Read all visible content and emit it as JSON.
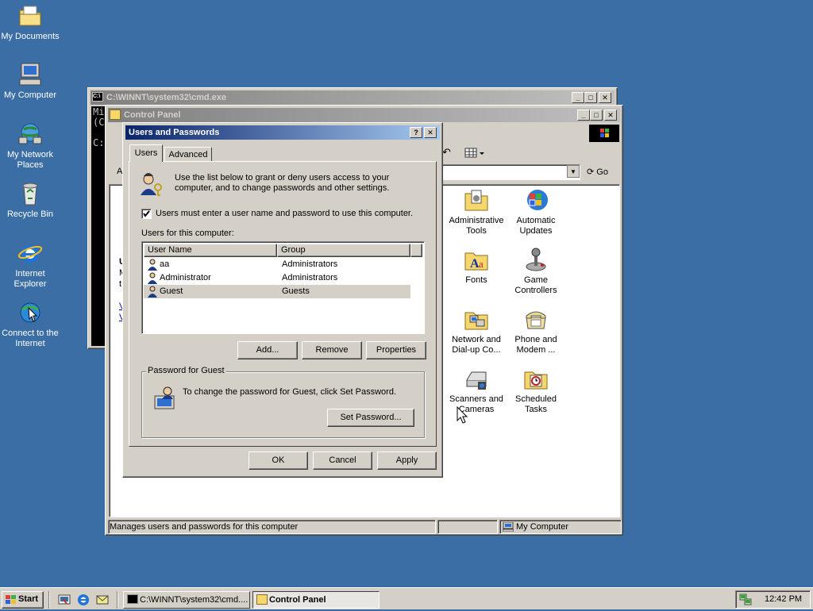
{
  "desktop": {
    "icons": [
      {
        "label": "My Documents"
      },
      {
        "label": "My Computer"
      },
      {
        "label": "My Network Places"
      },
      {
        "label": "Recycle Bin"
      },
      {
        "label": "Internet Explorer"
      },
      {
        "label": "Connect to the Internet"
      }
    ]
  },
  "cmd_window": {
    "title": "C:\\WINNT\\system32\\cmd.exe",
    "lines": [
      "Mi",
      "(C",
      "",
      "C:"
    ]
  },
  "control_panel": {
    "title": "Control Panel",
    "address_partial": "A",
    "go_label": "Go",
    "left_partial": [
      "U",
      "M",
      "t",
      "V",
      "V"
    ],
    "items": [
      {
        "label": "Administrative Tools",
        "icon": "admin-tools-icon"
      },
      {
        "label": "Automatic Updates",
        "icon": "windows-update-icon"
      },
      {
        "label": "Fonts",
        "icon": "fonts-folder-icon"
      },
      {
        "label": "Game Controllers",
        "icon": "joystick-icon"
      },
      {
        "label": "Network and Dial-up Co...",
        "icon": "network-folder-icon"
      },
      {
        "label": "Phone and Modem ...",
        "icon": "phone-icon"
      },
      {
        "label": "Scanners and Cameras",
        "icon": "scanner-icon"
      },
      {
        "label": "Scheduled Tasks",
        "icon": "scheduled-tasks-icon"
      }
    ],
    "status_text": "Manages users and passwords for this computer",
    "status_zone": "My Computer"
  },
  "dialog": {
    "title": "Users and Passwords",
    "help_btn": "?",
    "close_btn": "✕",
    "tabs": [
      {
        "label": "Users"
      },
      {
        "label": "Advanced"
      }
    ],
    "intro": "Use the list below to grant or deny users access to your computer, and to change passwords and other settings.",
    "checkbox_label": "Users must enter a user name and password to use this computer.",
    "checkbox_checked": true,
    "users_label": "Users for this computer:",
    "columns": [
      "User Name",
      "Group"
    ],
    "users": [
      {
        "name": "aa",
        "group": "Administrators"
      },
      {
        "name": "Administrator",
        "group": "Administrators"
      },
      {
        "name": "Guest",
        "group": "Guests",
        "selected": true
      }
    ],
    "add_btn": "Add...",
    "remove_btn": "Remove",
    "properties_btn": "Properties",
    "pw_group_label": "Password for Guest",
    "pw_text": "To change the password for Guest, click Set Password.",
    "set_pw_btn": "Set Password...",
    "ok_btn": "OK",
    "cancel_btn": "Cancel",
    "apply_btn": "Apply"
  },
  "taskbar": {
    "start_label": "Start",
    "tasks": [
      {
        "label": "C:\\WINNT\\system32\\cmd...."
      },
      {
        "label": "Control Panel",
        "active": true
      }
    ],
    "clock": "12:42 PM"
  }
}
